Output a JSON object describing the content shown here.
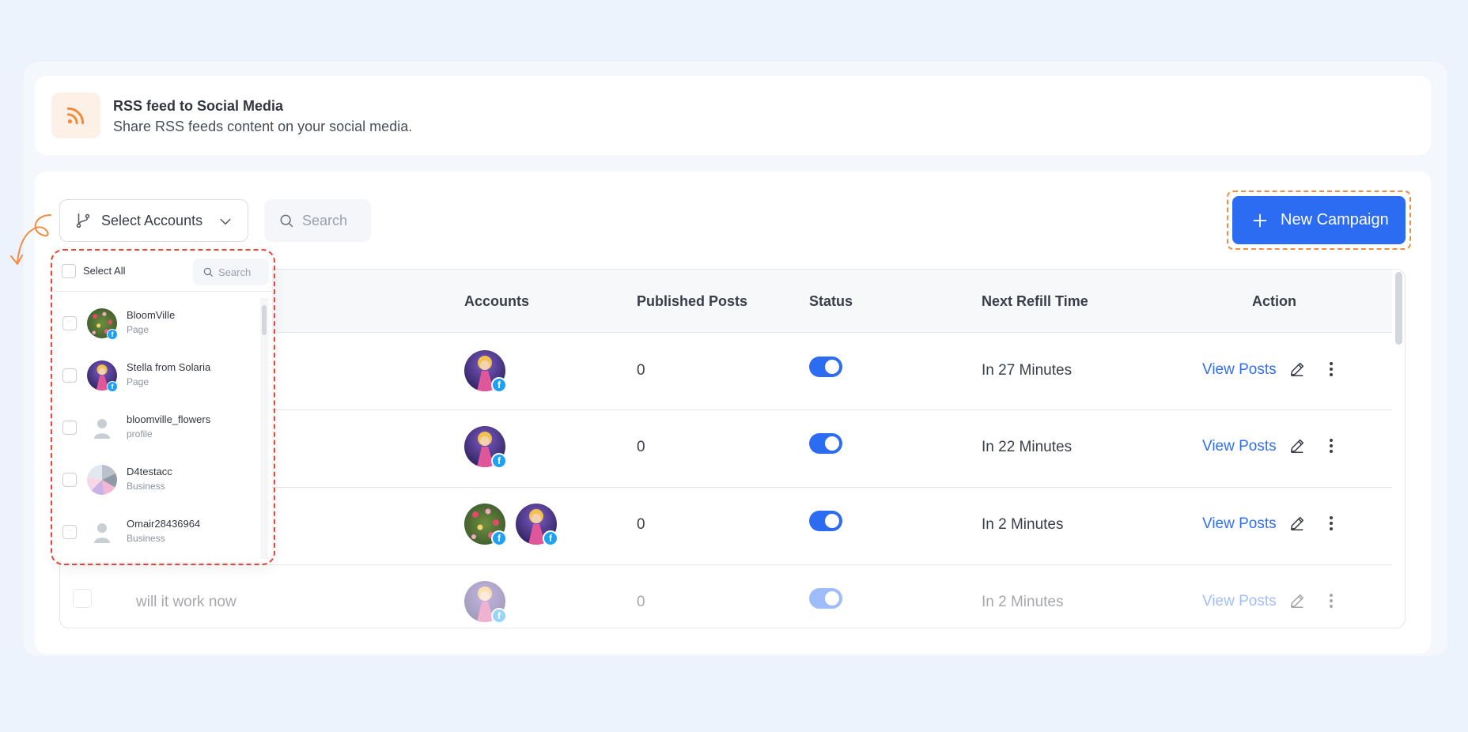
{
  "header": {
    "icon": "rss-icon",
    "title": "RSS feed to Social Media",
    "subtitle": "Share RSS feeds content on your social media."
  },
  "toolbar": {
    "select_accounts_label": "Select Accounts",
    "search_placeholder": "Search",
    "new_campaign_label": "New Campaign"
  },
  "table": {
    "columns": [
      "Accounts",
      "Published Posts",
      "Status",
      "Next Refill Time",
      "Action"
    ],
    "rows": [
      {
        "name": "",
        "accounts": [
          "stella"
        ],
        "published": "0",
        "status": "on",
        "refill": "In 27 Minutes",
        "action": "View Posts"
      },
      {
        "name": "",
        "accounts": [
          "stella"
        ],
        "published": "0",
        "status": "on",
        "refill": "In 22 Minutes",
        "action": "View Posts"
      },
      {
        "name": "",
        "accounts": [
          "bloomville",
          "stella"
        ],
        "published": "0",
        "status": "on",
        "refill": "In 2 Minutes",
        "action": "View Posts"
      },
      {
        "name": "will it work now",
        "accounts": [
          "stella"
        ],
        "published": "0",
        "status": "on",
        "refill": "In 2 Minutes",
        "action": "View Posts"
      }
    ]
  },
  "dropdown": {
    "select_all_label": "Select All",
    "search_placeholder": "Search",
    "items": [
      {
        "name": "BloomVille",
        "type": "Page",
        "avatar": "bloomville",
        "facebook": true
      },
      {
        "name": "Stella from Solaria",
        "type": "Page",
        "avatar": "stella",
        "facebook": true
      },
      {
        "name": "bloomville_flowers",
        "type": "profile",
        "avatar": "placeholder",
        "facebook": false
      },
      {
        "name": "D4testacc",
        "type": "Business",
        "avatar": "pastel",
        "facebook": false
      },
      {
        "name": "Omair28436964",
        "type": "Business",
        "avatar": "placeholder",
        "facebook": false
      }
    ]
  },
  "colors": {
    "accent": "#2b6cf2",
    "link": "#2f6ff0",
    "highlight_outline": "#f28b44",
    "dropdown_outline": "#ea4a39",
    "rss_orange": "#f58a3a"
  }
}
